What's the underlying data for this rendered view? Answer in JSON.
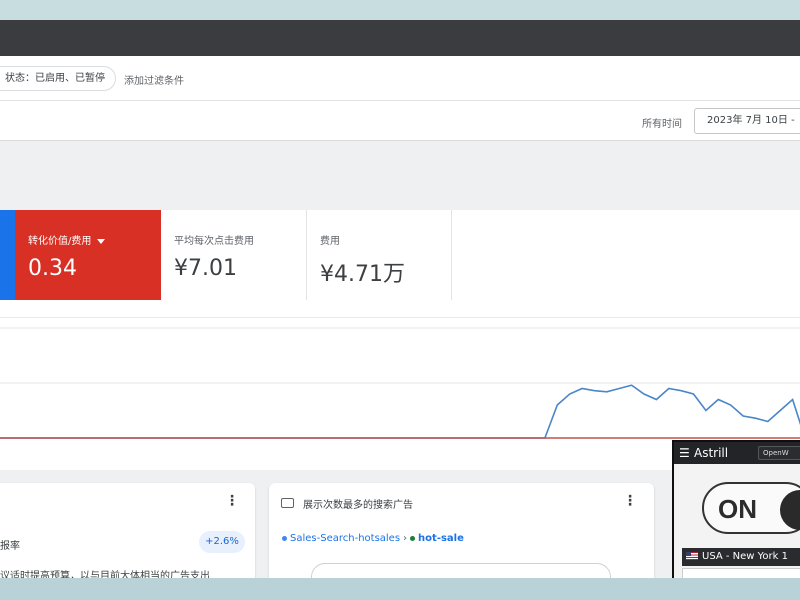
{
  "filter_bar": {
    "status_chip": "状态：已启用、已暂停",
    "add_filter": "添加过滤条件"
  },
  "date_bar": {
    "label": "所有时间",
    "range": "2023年 7月 10日 -"
  },
  "metrics": [
    {
      "label": "转化价值/费用",
      "value": "0.34",
      "color": "#d93025",
      "selected": true
    },
    {
      "label": "平均每次点击费用",
      "value": "¥7.01"
    },
    {
      "label": "费用",
      "value": "¥4.71万"
    }
  ],
  "chart_data": {
    "type": "line",
    "title": "",
    "xlabel": "",
    "ylabel": "",
    "grid": true,
    "ylim": [
      0,
      100
    ],
    "x": [
      0,
      1,
      2,
      3,
      4,
      5,
      6,
      7,
      8,
      9,
      10,
      11,
      12,
      13,
      14,
      15,
      16,
      17,
      18,
      19,
      20,
      21,
      22,
      23,
      24,
      25,
      26,
      27,
      28,
      29,
      30,
      31,
      32,
      33,
      34,
      35,
      36,
      37,
      38,
      39,
      40,
      41,
      42,
      43,
      44,
      45,
      46,
      47,
      48,
      49,
      50,
      51,
      52,
      53,
      54,
      55,
      56,
      57,
      58,
      59,
      60,
      61,
      62,
      63,
      64,
      65
    ],
    "series": [
      {
        "color": "#4a86c8",
        "values": [
          0,
          0,
          0,
          0,
          0,
          0,
          0,
          0,
          0,
          0,
          0,
          0,
          0,
          0,
          0,
          0,
          0,
          0,
          0,
          0,
          0,
          0,
          0,
          0,
          0,
          0,
          0,
          0,
          0,
          0,
          0,
          0,
          0,
          0,
          0,
          0,
          0,
          0,
          0,
          0,
          0,
          0,
          0,
          0,
          0,
          30,
          40,
          45,
          43,
          42,
          45,
          48,
          40,
          35,
          45,
          43,
          40,
          25,
          35,
          30,
          20,
          18,
          15,
          25,
          35,
          0
        ]
      },
      {
        "color": "#c0504d",
        "values": [
          0,
          0,
          0,
          0,
          0,
          0,
          0,
          0,
          0,
          0,
          0,
          0,
          0,
          0,
          0,
          0,
          0,
          0,
          0,
          0,
          0,
          0,
          0,
          0,
          0,
          0,
          0,
          0,
          0,
          0,
          0,
          0,
          0,
          0,
          0,
          0,
          0,
          0,
          0,
          0,
          0,
          0,
          0,
          0,
          0,
          0,
          0,
          0,
          0,
          0,
          0,
          0,
          0,
          0,
          0,
          0,
          0,
          0,
          0,
          0,
          0,
          0,
          0,
          0,
          0,
          0
        ]
      }
    ]
  },
  "card_left": {
    "subtitle": "报率",
    "badge": "+2.6%",
    "description": "议适时提高预算，以与目前大体相当的广告支出"
  },
  "card_right": {
    "title": "展示次数最多的搜索广告",
    "campaign": "Sales-Search-hotsales",
    "separator": "›",
    "ad_group": "hot-sale"
  },
  "astrill": {
    "title": "Astrill",
    "mode": "OpenW",
    "toggle": "ON",
    "server": "USA - New York 1"
  }
}
